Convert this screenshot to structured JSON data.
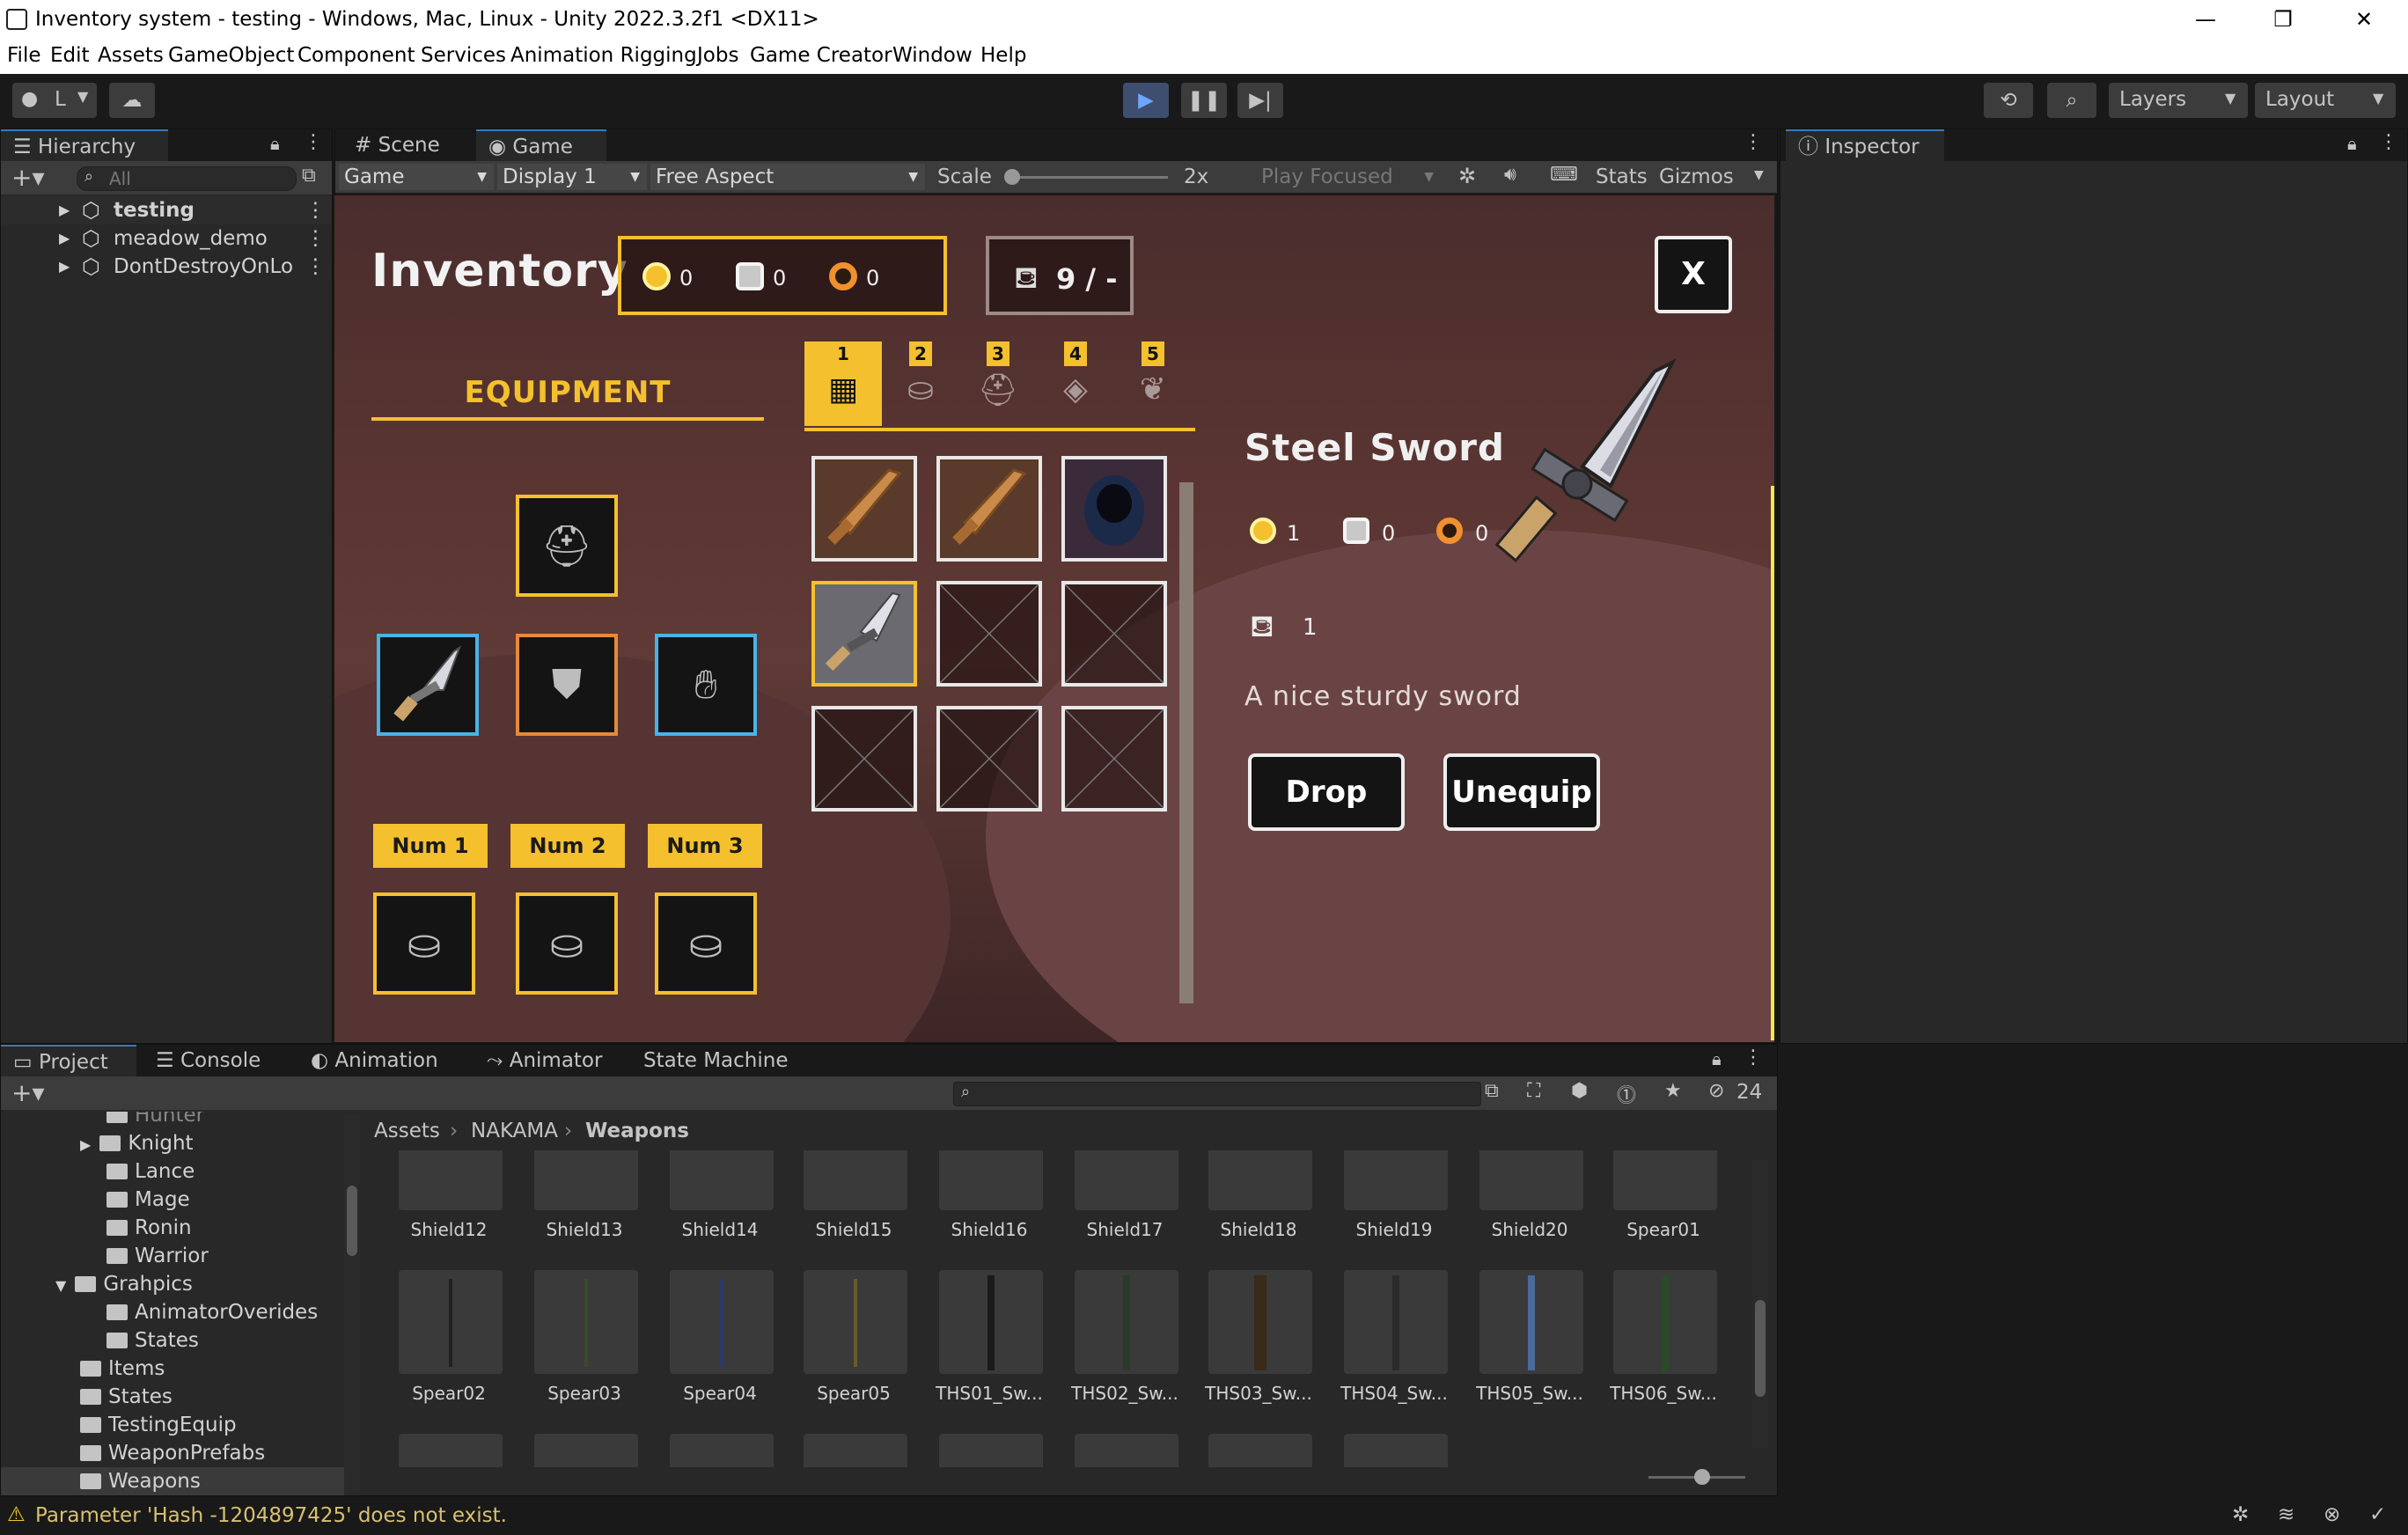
{
  "window": {
    "title": "Inventory system - testing - Windows, Mac, Linux - Unity 2022.3.2f1 <DX11>",
    "controls": [
      "—",
      "❐",
      "✕"
    ]
  },
  "menu": [
    "File",
    "Edit",
    "Assets",
    "GameObject",
    "Component",
    "Services",
    "Animation Rigging",
    "Jobs",
    "Game Creator",
    "Window",
    "Help"
  ],
  "toolbar": {
    "account": "L",
    "layers": "Layers",
    "layout": "Layout"
  },
  "hierarchy": {
    "tab": "Hierarchy",
    "search_placeholder": "All",
    "items": [
      "testing",
      "meadow_demo",
      "DontDestroyOnLo"
    ]
  },
  "scene_tabs": {
    "scene": "Scene",
    "game": "Game"
  },
  "game_bar": {
    "mode": "Game",
    "display": "Display 1",
    "aspect": "Free Aspect",
    "scale_label": "Scale",
    "scale_value": "2x",
    "play_focused": "Play Focused",
    "stats": "Stats",
    "gizmos": "Gizmos"
  },
  "inspector": {
    "tab": "Inspector"
  },
  "game": {
    "title": "Inventory",
    "currencies": [
      {
        "name": "gold",
        "value": "0",
        "color": "#f4c02e"
      },
      {
        "name": "silver",
        "value": "0",
        "color": "#cfcfcf"
      },
      {
        "name": "copper",
        "value": "0",
        "color": "#f0902e"
      }
    ],
    "weight": "9 / -",
    "close": "X",
    "equipment_label": "EQUIPMENT",
    "num_buttons": [
      "Num 1",
      "Num 2",
      "Num 3"
    ],
    "category_tabs": [
      "1",
      "2",
      "3",
      "4",
      "5"
    ],
    "item": {
      "name": "Steel Sword",
      "costs": [
        "1",
        "0",
        "0"
      ],
      "weight": "1",
      "description": "A nice sturdy sword"
    },
    "actions": {
      "drop": "Drop",
      "unequip": "Unequip"
    }
  },
  "bottom_tabs": [
    "Project",
    "Console",
    "Animation",
    "Animator",
    "State Machine"
  ],
  "project": {
    "breadcrumb": [
      "Assets",
      "NAKAMA",
      "Weapons"
    ],
    "hidden_count": "24",
    "tree": [
      "Hunter",
      "Knight",
      "Lance",
      "Mage",
      "Ronin",
      "Warrior",
      "Grahpics",
      "AnimatorOverides",
      "States",
      "Items",
      "States",
      "TestingEquip",
      "WeaponPrefabs",
      "Weapons"
    ],
    "assets_row1": [
      "Shield12",
      "Shield13",
      "Shield14",
      "Shield15",
      "Shield16",
      "Shield17",
      "Shield18",
      "Shield19",
      "Shield20",
      "Spear01"
    ],
    "assets_row2": [
      "Spear02",
      "Spear03",
      "Spear04",
      "Spear05",
      "THS01_Sw...",
      "THS02_Sw...",
      "THS03_Sw...",
      "THS04_Sw...",
      "THS05_Sw...",
      "THS06_Sw..."
    ]
  },
  "status": {
    "message": "Parameter 'Hash -1204897425' does not exist."
  }
}
